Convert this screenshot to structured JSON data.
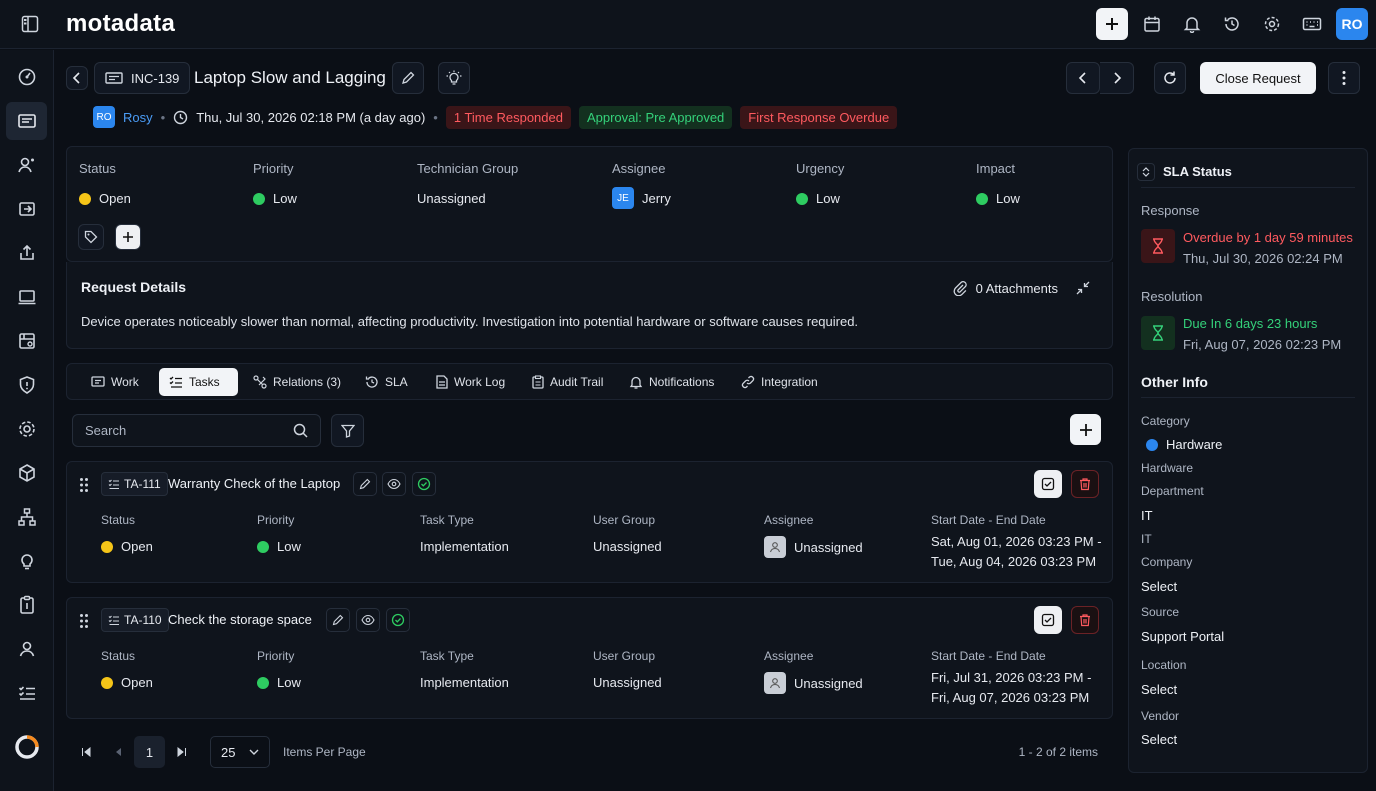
{
  "app": {
    "logo": "motadata",
    "user_initials": "RO"
  },
  "sidebar": {
    "items": [
      "dashboard-icon",
      "request-icon",
      "users-icon",
      "change-icon",
      "release-icon",
      "asset-icon",
      "catalog-icon",
      "security-icon",
      "settings-icon",
      "cmdb-icon",
      "topology-icon",
      "idea-icon",
      "contract-icon",
      "contacts-icon",
      "tasks-icon"
    ]
  },
  "request": {
    "id": "INC-139",
    "title": "Laptop Slow and Lagging",
    "requester": "Rosy",
    "requester_initials": "RO",
    "created": "Thu, Jul 30, 2026 02:18 PM (a day ago)",
    "badges": {
      "responded": "1 Time Responded",
      "approval": "Approval: Pre Approved",
      "overdue": "First Response Overdue"
    },
    "close_label": "Close Request"
  },
  "fields": {
    "status_label": "Status",
    "status": "Open",
    "priority_label": "Priority",
    "priority": "Low",
    "group_label": "Technician Group",
    "group": "Unassigned",
    "assignee_label": "Assignee",
    "assignee": "Jerry",
    "assignee_initials": "JE",
    "urgency_label": "Urgency",
    "urgency": "Low",
    "impact_label": "Impact",
    "impact": "Low"
  },
  "details": {
    "title": "Request Details",
    "attachments": "0 Attachments",
    "description": "Device operates noticeably slower than normal, affecting productivity. Investigation into potential hardware or software causes required."
  },
  "tabs": [
    {
      "label": "Work",
      "icon": "work-icon"
    },
    {
      "label": "Tasks",
      "icon": "tasks-icon"
    },
    {
      "label": "Relations (3)",
      "icon": "relations-icon"
    },
    {
      "label": "SLA",
      "icon": "sla-icon"
    },
    {
      "label": "Work Log",
      "icon": "worklog-icon"
    },
    {
      "label": "Audit Trail",
      "icon": "audit-icon"
    },
    {
      "label": "Notifications",
      "icon": "bell-icon"
    },
    {
      "label": "Integration",
      "icon": "link-icon"
    }
  ],
  "search": {
    "placeholder": "Search"
  },
  "task_headers": {
    "status": "Status",
    "priority": "Priority",
    "type": "Task Type",
    "group": "User Group",
    "assignee": "Assignee",
    "dates": "Start Date - End Date"
  },
  "tasks": [
    {
      "id": "TA-111",
      "title": "Warranty Check of the Laptop",
      "status": "Open",
      "priority": "Low",
      "type": "Implementation",
      "group": "Unassigned",
      "assignee": "Unassigned",
      "start": "Sat, Aug 01, 2026 03:23 PM -",
      "end": "Tue, Aug 04, 2026 03:23 PM"
    },
    {
      "id": "TA-110",
      "title": "Check the storage space",
      "status": "Open",
      "priority": "Low",
      "type": "Implementation",
      "group": "Unassigned",
      "assignee": "Unassigned",
      "start": "Fri, Jul 31, 2026 03:23 PM -",
      "end": "Fri, Aug 07, 2026 03:23 PM"
    }
  ],
  "pager": {
    "page": "1",
    "per_page": "25",
    "per_page_label": "Items Per Page",
    "summary": "1 - 2 of 2 items"
  },
  "sla": {
    "title": "SLA Status",
    "response_label": "Response",
    "response_status": "Overdue by 1 day 59 minutes",
    "response_date": "Thu, Jul 30, 2026 02:24 PM",
    "resolution_label": "Resolution",
    "resolution_status": "Due In 6 days 23 hours",
    "resolution_date": "Fri, Aug 07, 2026 02:23 PM"
  },
  "other": {
    "title": "Other Info",
    "category_label": "Category",
    "category": "Hardware",
    "hardware_label": "Hardware",
    "department_label": "Department",
    "department": "IT",
    "it_label": "IT",
    "company_label": "Company",
    "company": "Select",
    "source_label": "Source",
    "source": "Support Portal",
    "location_label": "Location",
    "location": "Select",
    "vendor_label": "Vendor",
    "vendor": "Select"
  },
  "colors": {
    "accent": "#2b86ee",
    "danger": "#ff5a5f",
    "success": "#34d17a",
    "open": "#f5c518",
    "low": "#2ecc61"
  }
}
